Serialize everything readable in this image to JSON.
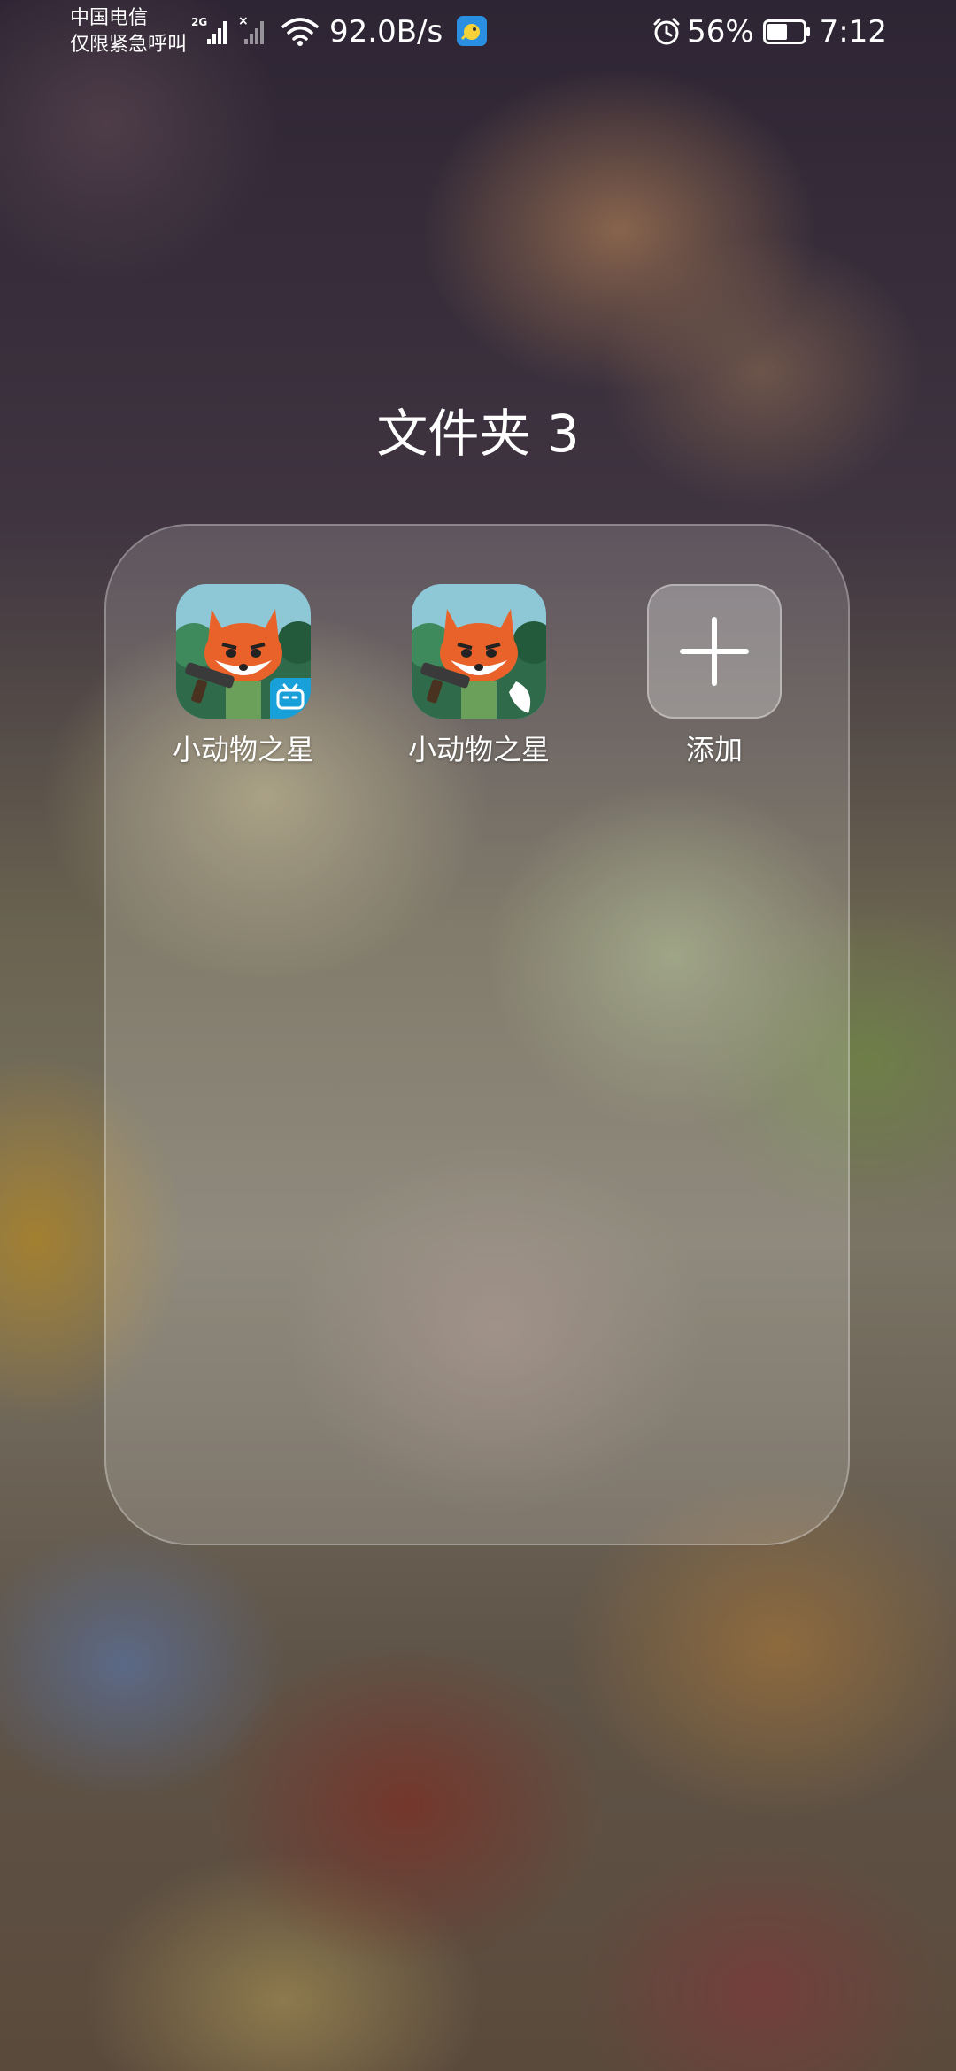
{
  "status_bar": {
    "carrier_line1": "中国电信",
    "carrier_line2": "仅限紧急呼叫",
    "network_type": "2G",
    "net_speed": "92.0B/s",
    "battery_percent": "56%",
    "battery_level": 0.56,
    "time": "7:12",
    "icons": [
      "signal-icon",
      "no-signal-icon",
      "wifi-icon",
      "notification-app-icon",
      "alarm-icon",
      "battery-icon"
    ]
  },
  "folder": {
    "title": "文件夹 3",
    "apps": [
      {
        "label": "小动物之星",
        "icon": "fox-game-icon",
        "badge": "bilibili-badge-icon"
      },
      {
        "label": "小动物之星",
        "icon": "fox-game-icon"
      }
    ],
    "add_label": "添加",
    "add_icon": "plus-icon"
  },
  "colors": {
    "fox_orange": "#e8622a",
    "badge_blue": "#1aa0d8",
    "icon_sky": "#8ec7d6",
    "icon_forest": "#2f6b4a"
  }
}
